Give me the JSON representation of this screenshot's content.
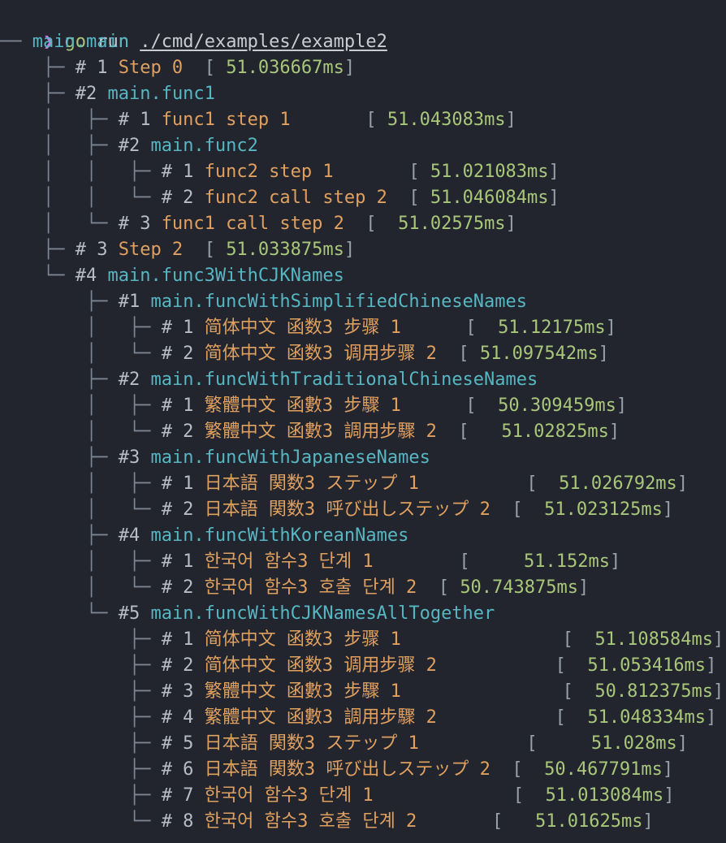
{
  "prompt": {
    "arrow": "❯",
    "go": "go",
    "run": "run",
    "path": "./cmd/examples/example2"
  },
  "lines": [
    {
      "indent": "── ",
      "num": "",
      "name": "main.main",
      "kind": "func",
      "dur": ""
    },
    {
      "indent": "    ├─ ",
      "num": "# 1 ",
      "name": "Step 0",
      "kind": "step",
      "pad": "  ",
      "dur": "51.036667ms"
    },
    {
      "indent": "    ├─ ",
      "num": "#2 ",
      "name": "main.func1",
      "kind": "func",
      "dur": ""
    },
    {
      "indent": "    │   ├─ ",
      "num": "# 1 ",
      "name": "func1 step 1",
      "kind": "step",
      "pad": "       ",
      "dur": "51.043083ms"
    },
    {
      "indent": "    │   ├─ ",
      "num": "#2 ",
      "name": "main.func2",
      "kind": "func",
      "dur": ""
    },
    {
      "indent": "    │   │   ├─ ",
      "num": "# 1 ",
      "name": "func2 step 1",
      "kind": "step",
      "pad": "       ",
      "dur": "51.021083ms"
    },
    {
      "indent": "    │   │   └─ ",
      "num": "# 2 ",
      "name": "func2 call step 2",
      "kind": "step",
      "pad": "  ",
      "dur": "51.046084ms"
    },
    {
      "indent": "    │   └─ ",
      "num": "# 3 ",
      "name": "func1 call step 2",
      "kind": "step",
      "pad": "  ",
      "dur": " 51.02575ms"
    },
    {
      "indent": "    ├─ ",
      "num": "# 3 ",
      "name": "Step 2",
      "kind": "step",
      "pad": "  ",
      "dur": "51.033875ms"
    },
    {
      "indent": "    └─ ",
      "num": "#4 ",
      "name": "main.func3WithCJKNames",
      "kind": "func",
      "dur": ""
    },
    {
      "indent": "        ├─ ",
      "num": "#1 ",
      "name": "main.funcWithSimplifiedChineseNames",
      "kind": "func",
      "dur": ""
    },
    {
      "indent": "        │   ├─ ",
      "num": "# 1 ",
      "name": "简体中文 函数3 步骤 1",
      "kind": "step",
      "pad": "      ",
      "dur": " 51.12175ms"
    },
    {
      "indent": "        │   └─ ",
      "num": "# 2 ",
      "name": "简体中文 函数3 调用步骤 2",
      "kind": "step",
      "pad": "  ",
      "dur": "51.097542ms"
    },
    {
      "indent": "        ├─ ",
      "num": "#2 ",
      "name": "main.funcWithTraditionalChineseNames",
      "kind": "func",
      "dur": ""
    },
    {
      "indent": "        │   ├─ ",
      "num": "# 1 ",
      "name": "繁體中文 函數3 步驟 1",
      "kind": "step",
      "pad": "      ",
      "dur": " 50.309459ms"
    },
    {
      "indent": "        │   └─ ",
      "num": "# 2 ",
      "name": "繁體中文 函數3 調用步驟 2",
      "kind": "step",
      "pad": "  ",
      "dur": "  51.02825ms"
    },
    {
      "indent": "        ├─ ",
      "num": "#3 ",
      "name": "main.funcWithJapaneseNames",
      "kind": "func",
      "dur": ""
    },
    {
      "indent": "        │   ├─ ",
      "num": "# 1 ",
      "name": "日本語 関数3 ステップ 1",
      "kind": "step",
      "pad": "          ",
      "dur": " 51.026792ms"
    },
    {
      "indent": "        │   └─ ",
      "num": "# 2 ",
      "name": "日本語 関数3 呼び出しステップ 2",
      "kind": "step",
      "pad": "  ",
      "dur": " 51.023125ms"
    },
    {
      "indent": "        ├─ ",
      "num": "#4 ",
      "name": "main.funcWithKoreanNames",
      "kind": "func",
      "dur": ""
    },
    {
      "indent": "        │   ├─ ",
      "num": "# 1 ",
      "name": "한국어 함수3 단계 1",
      "kind": "step",
      "pad": "        ",
      "dur": "    51.152ms"
    },
    {
      "indent": "        │   └─ ",
      "num": "# 2 ",
      "name": "한국어 함수3 호출 단계 2",
      "kind": "step",
      "pad": "  ",
      "dur": "50.743875ms"
    },
    {
      "indent": "        └─ ",
      "num": "#5 ",
      "name": "main.funcWithCJKNamesAllTogether",
      "kind": "func",
      "dur": ""
    },
    {
      "indent": "            ├─ ",
      "num": "# 1 ",
      "name": "简体中文 函数3 步骤 1",
      "kind": "step",
      "pad": "               ",
      "dur": " 51.108584ms"
    },
    {
      "indent": "            ├─ ",
      "num": "# 2 ",
      "name": "简体中文 函数3 调用步骤 2",
      "kind": "step",
      "pad": "           ",
      "dur": " 51.053416ms"
    },
    {
      "indent": "            ├─ ",
      "num": "# 3 ",
      "name": "繁體中文 函數3 步驟 1",
      "kind": "step",
      "pad": "               ",
      "dur": " 50.812375ms"
    },
    {
      "indent": "            ├─ ",
      "num": "# 4 ",
      "name": "繁體中文 函數3 調用步驟 2",
      "kind": "step",
      "pad": "           ",
      "dur": " 51.048334ms"
    },
    {
      "indent": "            ├─ ",
      "num": "# 5 ",
      "name": "日本語 関数3 ステップ 1",
      "kind": "step",
      "pad": "          ",
      "dur": "    51.028ms"
    },
    {
      "indent": "            ├─ ",
      "num": "# 6 ",
      "name": "日本語 関数3 呼び出しステップ 2",
      "kind": "step",
      "pad": "  ",
      "dur": " 50.467791ms"
    },
    {
      "indent": "            ├─ ",
      "num": "# 7 ",
      "name": "한국어 함수3 단계 1",
      "kind": "step",
      "pad": "             ",
      "dur": " 51.013084ms"
    },
    {
      "indent": "            └─ ",
      "num": "# 8 ",
      "name": "한국어 함수3 호출 단계 2",
      "kind": "step",
      "pad": "       ",
      "dur": "  51.01625ms"
    }
  ]
}
